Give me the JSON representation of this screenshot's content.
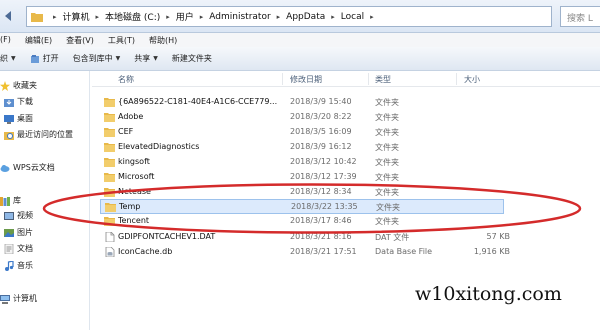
{
  "address": {
    "crumbs": [
      "计算机",
      "本地磁盘 (C:)",
      "用户",
      "Administrator",
      "AppData",
      "Local"
    ],
    "search_placeholder": "搜索 L"
  },
  "menu": [
    "(F)",
    "编辑(E)",
    "查看(V)",
    "工具(T)",
    "帮助(H)"
  ],
  "toolbar": {
    "organize": "织",
    "open": "打开",
    "include_in_library": "包含到库中",
    "share": "共享",
    "new_folder": "新建文件夹"
  },
  "sidebar": {
    "favorites": "收藏夹",
    "downloads": "下载",
    "desktop": "桌面",
    "recent": "最近访问的位置",
    "wps": "WPS云文档",
    "libraries": "库",
    "videos": "视频",
    "pictures": "图片",
    "documents": "文档",
    "music": "音乐",
    "computer": "计算机"
  },
  "columns": {
    "name": "名称",
    "date": "修改日期",
    "type": "类型",
    "size": "大小"
  },
  "files": [
    {
      "name": "{6A896522-C181-40E4-A1C6-CCE779...",
      "date": "2018/3/9 15:40",
      "type": "文件夹",
      "size": "",
      "icon": "folder-icon"
    },
    {
      "name": "Adobe",
      "date": "2018/3/20 8:22",
      "type": "文件夹",
      "size": "",
      "icon": "folder-icon"
    },
    {
      "name": "CEF",
      "date": "2018/3/5 16:09",
      "type": "文件夹",
      "size": "",
      "icon": "folder-icon"
    },
    {
      "name": "ElevatedDiagnostics",
      "date": "2018/3/9 16:12",
      "type": "文件夹",
      "size": "",
      "icon": "folder-icon"
    },
    {
      "name": "kingsoft",
      "date": "2018/3/12 10:42",
      "type": "文件夹",
      "size": "",
      "icon": "folder-icon"
    },
    {
      "name": "Microsoft",
      "date": "2018/3/12 17:39",
      "type": "文件夹",
      "size": "",
      "icon": "folder-icon"
    },
    {
      "name": "Netease",
      "date": "2018/3/12 8:34",
      "type": "文件夹",
      "size": "",
      "icon": "folder-icon"
    },
    {
      "name": "Temp",
      "date": "2018/3/22 13:35",
      "type": "文件夹",
      "size": "",
      "icon": "folder-icon",
      "selected": true
    },
    {
      "name": "Tencent",
      "date": "2018/3/17 8:46",
      "type": "文件夹",
      "size": "",
      "icon": "folder-icon"
    },
    {
      "name": "GDIPFONTCACHEV1.DAT",
      "date": "2018/3/21 8:16",
      "type": "DAT 文件",
      "size": "57 KB",
      "icon": "file-icon"
    },
    {
      "name": "IconCache.db",
      "date": "2018/3/21 17:51",
      "type": "Data Base File",
      "size": "1,916 KB",
      "icon": "db-file-icon"
    }
  ],
  "watermark": "w10xitong.com",
  "colors": {
    "annotation": "#d42b2b",
    "selection": "#dceafc",
    "folder": "#e8b94a"
  }
}
